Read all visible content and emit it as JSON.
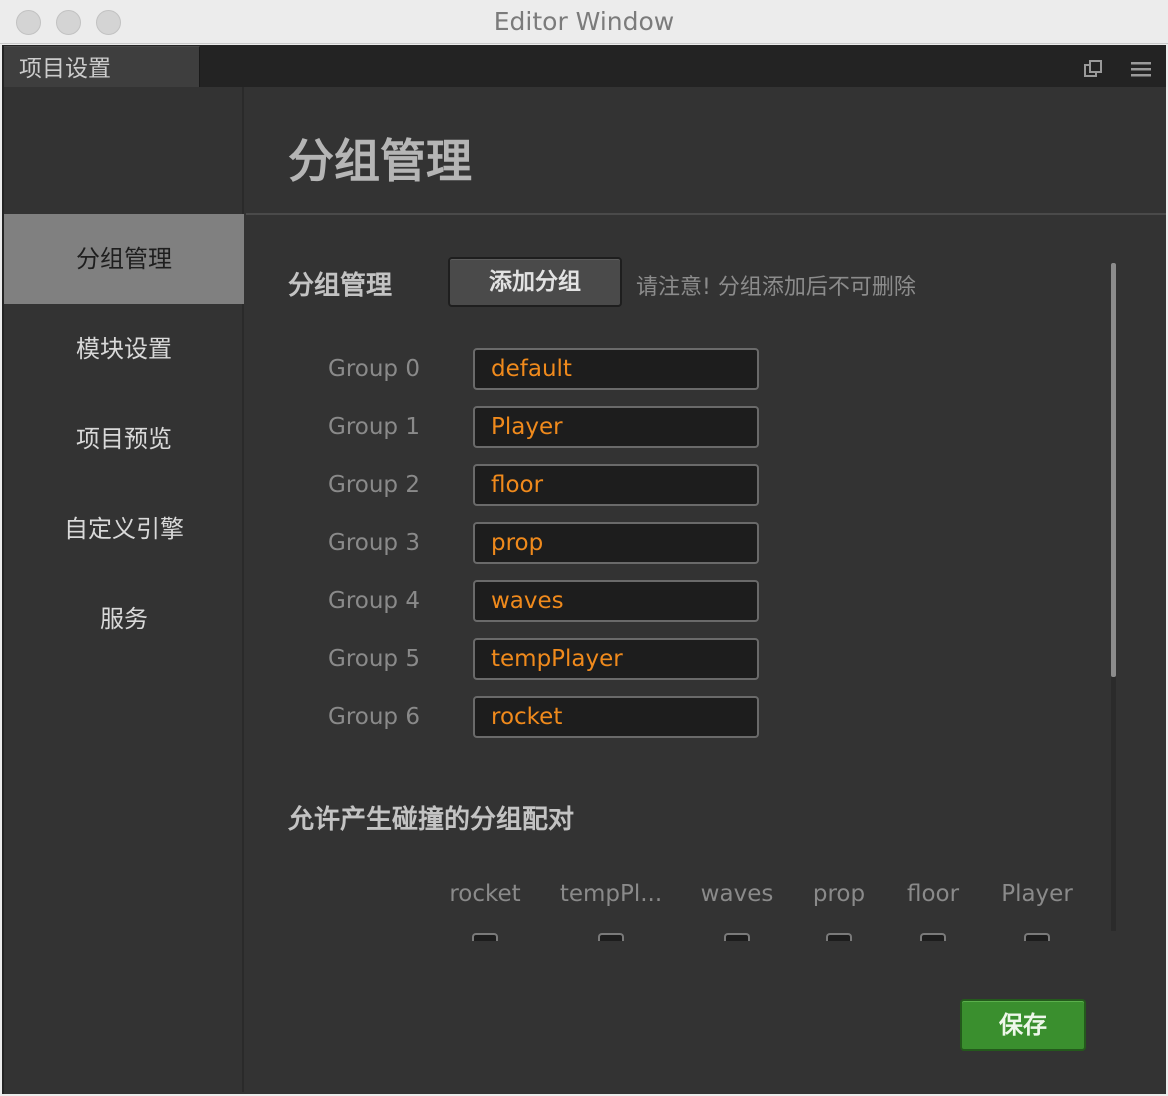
{
  "window": {
    "title": "Editor Window"
  },
  "tab": {
    "label": "项目设置",
    "popout_icon": "popout-icon",
    "menu_icon": "hamburger-menu-icon"
  },
  "sidebar": {
    "items": [
      {
        "label": "分组管理",
        "active": true
      },
      {
        "label": "模块设置",
        "active": false
      },
      {
        "label": "项目预览",
        "active": false
      },
      {
        "label": "自定义引擎",
        "active": false
      },
      {
        "label": "服务",
        "active": false
      }
    ]
  },
  "main": {
    "page_title": "分组管理",
    "groups_section": {
      "title": "分组管理",
      "add_button": "添加分组",
      "notice": "请注意! 分组添加后不可删除"
    },
    "groups": [
      {
        "label": "Group 0",
        "value": "default"
      },
      {
        "label": "Group 1",
        "value": "Player"
      },
      {
        "label": "Group 2",
        "value": "floor"
      },
      {
        "label": "Group 3",
        "value": "prop"
      },
      {
        "label": "Group 4",
        "value": "waves"
      },
      {
        "label": "Group 5",
        "value": "tempPlayer"
      },
      {
        "label": "Group 6",
        "value": "rocket"
      }
    ],
    "collision_section": {
      "title": "允许产生碰撞的分组配对",
      "columns": [
        "rocket",
        "tempPl...",
        "waves",
        "prop",
        "floor",
        "Player"
      ]
    },
    "save_button": "保存"
  },
  "colors": {
    "accent_text": "#f08a1c",
    "save_button": "#3a8f2e",
    "sidebar_active": "#808080"
  }
}
